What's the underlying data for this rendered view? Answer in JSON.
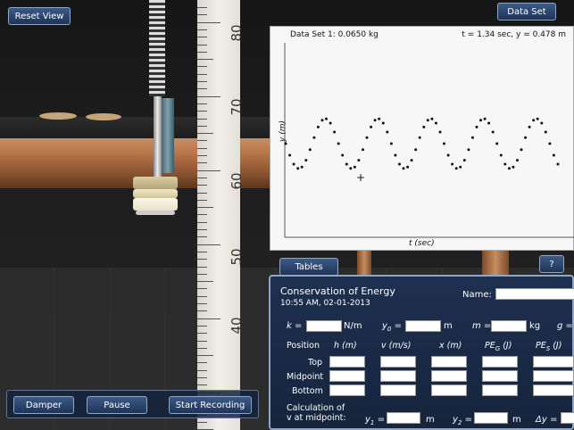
{
  "toolbar": {
    "reset_view": "Reset View",
    "data_set": "Data Set",
    "tables": "Tables",
    "help": "?"
  },
  "controls": {
    "damper": "Damper",
    "pause": "Pause",
    "start_recording": "Start Recording"
  },
  "ruler": {
    "labels": [
      "80",
      "70",
      "60",
      "50",
      "40"
    ]
  },
  "graph": {
    "header_left": "Data Set 1: 0.0650 kg",
    "header_right": "t = 1.34 sec, y = 0.478 m",
    "ylabel": "y (m)",
    "xlabel": "t (sec)",
    "cursor": "+"
  },
  "chart_data": {
    "type": "scatter",
    "title": "Data Set 1: 0.0650 kg",
    "xlabel": "t (sec)",
    "ylabel": "y (m)",
    "series": [
      {
        "name": "Data Set 1",
        "points_per_cycle": 13,
        "cycles": 5.2,
        "phase_start": "mid-descending"
      }
    ],
    "grid": false
  },
  "panel": {
    "title": "Conservation of Energy",
    "timestamp": "10:55 AM, 02-01-2013",
    "name_label": "Name:",
    "k_label": "k =",
    "k_unit": "N/m",
    "y0_label": "y",
    "y0_sub": "0",
    "y0_eq": "=",
    "y0_unit": "m",
    "m_label": "m =",
    "m_unit": "kg",
    "g_label": "g =",
    "col_position": "Position",
    "col_h": "h (m)",
    "col_v": "v (m/s)",
    "col_x": "x (m)",
    "col_peg": "PE",
    "col_peg_sub": "G",
    "col_peg_unit": " (J)",
    "col_pes": "PE",
    "col_pes_sub": "S",
    "col_pes_unit": " (J)",
    "row_top": "Top",
    "row_mid": "Midpoint",
    "row_bottom": "Bottom",
    "calc_line1": "Calculation of",
    "calc_line2": "v at midpoint:",
    "y1_label": "y",
    "y1_sub": "1",
    "y1_eq": "=",
    "y1_unit": "m",
    "y2_label": "y",
    "y2_sub": "2",
    "y2_eq": "=",
    "y2_unit": "m",
    "dy_label": "Δy ="
  }
}
